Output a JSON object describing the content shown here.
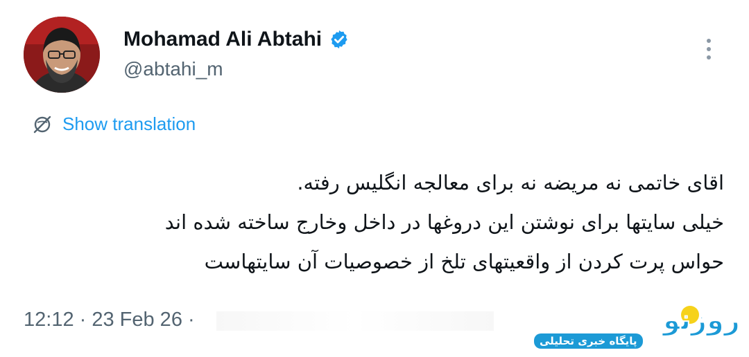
{
  "author": {
    "name": "Mohamad Ali Abtahi",
    "handle": "@abtahi_m",
    "verified": true
  },
  "translate": {
    "label": "Show translation"
  },
  "tweet": {
    "lines": [
      "اقای خاتمی نه مریضه نه برای معالجه انگلیس رفته.",
      "خیلی سایتها برای نوشتن این دروغها در داخل وخارج ساخته شده اند",
      "حواس پرت کردن از واقعیتهای تلخ از خصوصیات آن سایتهاست"
    ]
  },
  "meta": {
    "timestamp": "12:12 · 23 Feb 26 ·"
  },
  "watermark": {
    "logo": "روزنو",
    "label": "پایگاه خبری تحلیلی"
  },
  "colors": {
    "accent": "#1d9bf0",
    "muted": "#536471",
    "text": "#0f1419",
    "watermark": "#1c9ad6"
  },
  "icons": {
    "verified": "verified-badge-icon",
    "more": "more-vertical-icon",
    "translate": "globe-slash-icon"
  }
}
